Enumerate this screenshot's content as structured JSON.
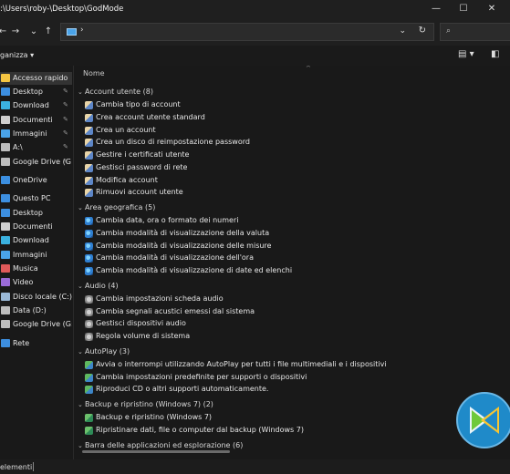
{
  "window": {
    "title": ":\\Users\\roby-\\Desktop\\GodMode",
    "minimize_glyph": "—",
    "maximize_glyph": "☐",
    "close_glyph": "✕"
  },
  "nav": {
    "back_glyph": "←",
    "forward_glyph": "→",
    "recent_glyph": "⌄",
    "up_glyph": "↑",
    "address_separator": "›",
    "address_dropdown_glyph": "⌄",
    "refresh_glyph": "↻",
    "search_glyph": "⌕"
  },
  "toolbar": {
    "organize_label": "ganizza ▾",
    "view_label": "▤ ▾",
    "pane_label": "◧"
  },
  "sidebar": {
    "items": [
      {
        "label": "Accesso rapido",
        "icon": "star-icon",
        "color": "#f5c542",
        "pin": ""
      },
      {
        "label": "Desktop",
        "icon": "desktop-icon",
        "color": "#3d8fe0",
        "pin": "✎"
      },
      {
        "label": "Download",
        "icon": "download-icon",
        "color": "#3bb2e0",
        "pin": "✎"
      },
      {
        "label": "Documenti",
        "icon": "documents-icon",
        "color": "#cfcfcf",
        "pin": "✎"
      },
      {
        "label": "Immagini",
        "icon": "pictures-icon",
        "color": "#4aa3e8",
        "pin": "✎"
      },
      {
        "label": "A:\\",
        "icon": "drive-icon",
        "color": "#bdbdbd",
        "pin": "✎"
      },
      {
        "label": "Google Drive (G",
        "icon": "google-drive-icon",
        "color": "#bdbdbd",
        "pin": "✎"
      },
      {
        "label": "OneDrive",
        "icon": "onedrive-icon",
        "color": "#3c8fe0",
        "pin": ""
      },
      {
        "label": "Questo PC",
        "icon": "pc-icon",
        "color": "#3d8fe0",
        "pin": ""
      },
      {
        "label": "Desktop",
        "icon": "desktop-icon",
        "color": "#3d8fe0",
        "pin": ""
      },
      {
        "label": "Documenti",
        "icon": "documents-icon",
        "color": "#cfcfcf",
        "pin": ""
      },
      {
        "label": "Download",
        "icon": "download-icon",
        "color": "#3bb2e0",
        "pin": ""
      },
      {
        "label": "Immagini",
        "icon": "pictures-icon",
        "color": "#4aa3e8",
        "pin": ""
      },
      {
        "label": "Musica",
        "icon": "music-icon",
        "color": "#e05a5a",
        "pin": ""
      },
      {
        "label": "Video",
        "icon": "video-icon",
        "color": "#9b6bd8",
        "pin": ""
      },
      {
        "label": "Disco locale (C:)",
        "icon": "disk-icon",
        "color": "#9ab8d6",
        "pin": ""
      },
      {
        "label": "Data (D:)",
        "icon": "disk-icon",
        "color": "#bdbdbd",
        "pin": ""
      },
      {
        "label": "Google Drive (G:)",
        "icon": "google-drive-icon",
        "color": "#bdbdbd",
        "pin": ""
      },
      {
        "label": "Rete",
        "icon": "network-icon",
        "color": "#3d8fe0",
        "pin": ""
      }
    ]
  },
  "main": {
    "column_header": "Nome",
    "sort_glyph": "^",
    "groups": [
      {
        "label": "Account utente (8)",
        "icon": "ic-users",
        "items": [
          "Cambia tipo di account",
          "Crea account utente standard",
          "Crea un account",
          "Crea un disco di reimpostazione password",
          "Gestire i certificati utente",
          "Gestisci password di rete",
          "Modifica account",
          "Rimuovi account utente"
        ]
      },
      {
        "label": "Area geografica (5)",
        "icon": "ic-globe",
        "items": [
          "Cambia data, ora o formato dei numeri",
          "Cambia modalità di visualizzazione della valuta",
          "Cambia modalità di visualizzazione delle misure",
          "Cambia modalità di visualizzazione dell'ora",
          "Cambia modalità di visualizzazione di date ed elenchi"
        ]
      },
      {
        "label": "Audio (4)",
        "icon": "ic-audio",
        "items": [
          "Cambia impostazioni scheda audio",
          "Cambia segnali acustici emessi dal sistema",
          "Gestisci dispositivi audio",
          "Regola volume di sistema"
        ]
      },
      {
        "label": "AutoPlay (3)",
        "icon": "ic-autoplay",
        "items": [
          "Avvia o interrompi utilizzando AutoPlay per tutti i file multimediali e i dispositivi",
          "Cambia impostazioni predefinite per supporti o dispositivi",
          "Riproduci CD o altri supporti automaticamente."
        ]
      },
      {
        "label": "Backup e ripristino (Windows 7) (2)",
        "icon": "ic-backup",
        "items": [
          "Backup e ripristino (Windows 7)",
          "Ripristinare dati, file o computer dal backup (Windows 7)"
        ]
      },
      {
        "label": "Barra delle applicazioni ed esplorazione (6)",
        "icon": "",
        "items": []
      }
    ]
  },
  "status": {
    "text": "elementi"
  },
  "colors": {
    "accent": "#1f8ac9"
  }
}
